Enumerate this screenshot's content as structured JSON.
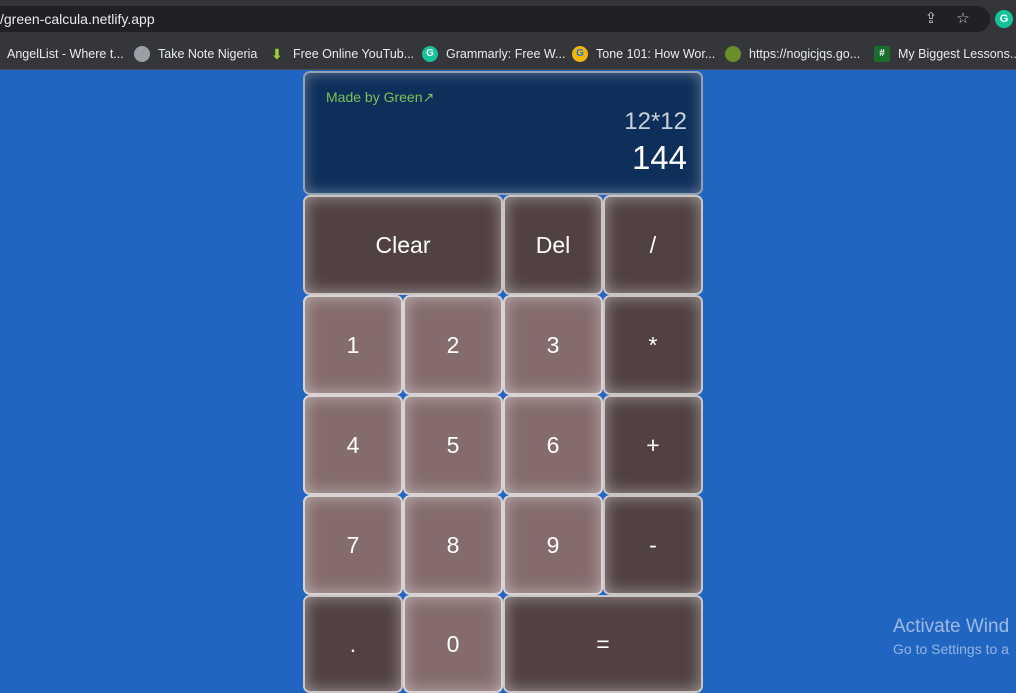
{
  "browser": {
    "url": "/green-calcula.netlify.app",
    "bookmarks": [
      {
        "label": "AngelList - Where t...",
        "icon": "angellist-icon"
      },
      {
        "label": "Take Note Nigeria",
        "icon": "globe-icon"
      },
      {
        "label": "Free Online YouTub...",
        "icon": "download-arrow-icon"
      },
      {
        "label": "Grammarly: Free W...",
        "icon": "grammarly-icon"
      },
      {
        "label": "Tone 101: How Wor...",
        "icon": "google-icon"
      },
      {
        "label": "https://nogicjqs.go...",
        "icon": "green-badge-icon"
      },
      {
        "label": "My Biggest Lessons...",
        "icon": "hashnode-icon"
      }
    ],
    "colors": {
      "grammarly": "#15c39a"
    }
  },
  "calculator": {
    "credit": "Made by Green↗",
    "previous": "12*12",
    "current": "144",
    "keys": {
      "clear": "Clear",
      "del": "Del",
      "divide": "/",
      "one": "1",
      "two": "2",
      "three": "3",
      "multiply": "*",
      "four": "4",
      "five": "5",
      "six": "6",
      "plus": "+",
      "seven": "7",
      "eight": "8",
      "nine": "9",
      "minus": "-",
      "dot": ".",
      "zero": "0",
      "equals": "="
    },
    "colors": {
      "background": "#2165c2",
      "display": "#0e2f5a",
      "key_dark": "#514142",
      "key_light": "#846c6c",
      "credit": "#78c257"
    }
  },
  "watermark": {
    "line1": "Activate Wind",
    "line2": "Go to Settings to a"
  }
}
